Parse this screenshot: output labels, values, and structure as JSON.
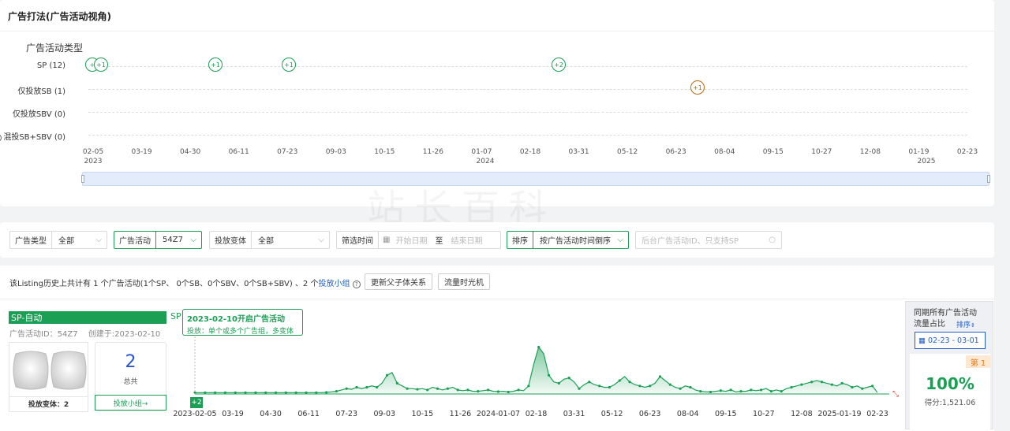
{
  "header": {
    "title": "广告打法(广告活动视角)"
  },
  "timeline": {
    "heading": "广告活动类型",
    "rows": [
      {
        "label": "SP (12)"
      },
      {
        "label": "仅投放SB (1)"
      },
      {
        "label": "仅投放SBV (0)"
      },
      {
        "label": "混投SB+SBV (0)"
      }
    ],
    "sp_markers": [
      "+",
      "+1",
      "+1",
      "+1",
      "+2"
    ],
    "sb_markers": [
      "+1"
    ],
    "axis_ticks": [
      "02-05",
      "03-19",
      "04-30",
      "06-11",
      "07-23",
      "09-03",
      "10-15",
      "11-26",
      "01-07",
      "02-18",
      "03-31",
      "05-12",
      "06-23",
      "08-04",
      "09-15",
      "10-27",
      "12-08",
      "01-19",
      "02-23"
    ],
    "axis_years": [
      "2023",
      "2024",
      "2025"
    ],
    "help_icon": "question-circle-icon"
  },
  "filters": {
    "ad_type": {
      "label": "广告类型",
      "value": "全部"
    },
    "campaign": {
      "label": "广告活动",
      "value": "54Z7"
    },
    "variant": {
      "label": "投放变体",
      "value": "全部"
    },
    "time": {
      "label": "筛选时间",
      "start_placeholder": "开始日期",
      "sep": "至",
      "end_placeholder": "结束日期"
    },
    "sort": {
      "label": "排序",
      "value": "按广告活动时间倒序"
    },
    "search": {
      "placeholder": "后台广告活动ID、只支持SP"
    }
  },
  "summary": {
    "text_a": "该Listing历史上共计有 1 个广告活动(1个SP、 0个SB、0个SBV、0个SB+SBV) 、2 个",
    "link": "投放小组",
    "btn_update": "更新父子体关系",
    "btn_machine": "流量时光机"
  },
  "campaign": {
    "name": "SP-自动",
    "sp_tag": "SP",
    "id_label": "广告活动ID：54Z7",
    "created": "创建于:2023-02-10",
    "variants_label": "投放变体：2",
    "count": "2",
    "count_label": "总共",
    "group_button": "投放小组→",
    "tooltip_title": "2023-02-10开启广告活动",
    "tooltip_body": "投放：单个或多个广告组，多变体",
    "badge": "+2"
  },
  "chart_data": {
    "type": "area",
    "color": "#1a9f54",
    "x_labels": [
      "2023-02-05",
      "03-19",
      "04-30",
      "06-11",
      "07-23",
      "09-03",
      "10-15",
      "11-26",
      "2024-01-07",
      "02-18",
      "03-31",
      "05-12",
      "06-23",
      "08-04",
      "09-15",
      "10-27",
      "12-08",
      "2025-01-19",
      "02-23"
    ],
    "values": [
      1,
      1,
      1,
      1,
      1,
      1,
      1,
      1,
      1,
      1,
      1,
      1,
      1,
      1,
      1,
      1,
      1,
      1,
      1,
      1,
      1,
      1,
      1,
      1,
      1,
      1,
      1.2,
      1.5,
      2,
      3,
      4,
      3.5,
      5,
      4,
      5,
      6,
      5,
      8,
      14,
      16,
      8,
      6,
      4,
      4,
      3.5,
      4,
      3,
      5,
      4,
      3,
      4,
      5,
      3,
      2.5,
      3,
      2,
      2,
      2.5,
      3,
      2,
      1.8,
      2,
      1.5,
      2,
      3,
      2.5,
      6,
      22,
      35,
      30,
      14,
      9,
      8,
      11,
      12,
      9,
      4,
      7,
      9,
      7,
      6,
      5,
      5,
      7,
      10,
      13,
      9,
      7,
      6,
      5,
      6,
      8,
      13,
      10,
      7,
      5,
      4,
      6,
      5,
      3,
      2,
      1.5,
      1.5,
      2,
      2.5,
      2,
      3,
      1.5,
      2,
      2,
      3,
      2.5,
      3,
      4,
      2,
      3,
      2,
      4,
      5,
      6,
      7,
      8,
      9,
      10,
      9,
      8,
      7,
      6,
      8,
      7,
      5,
      6,
      4,
      5,
      6,
      1
    ],
    "ylim": [
      0,
      40
    ]
  },
  "side": {
    "title_l1": "同期所有广告活动",
    "title_l2": "流量占比",
    "sort": "排序",
    "date_range": "02-23 - 03-01",
    "rank": "第 1",
    "percent": "100%",
    "score": "得分:1,521.06"
  },
  "watermark": "站长百科"
}
